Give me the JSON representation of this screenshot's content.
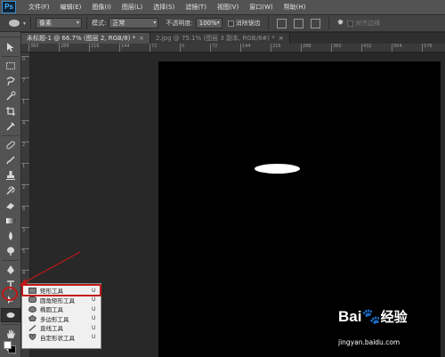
{
  "app": {
    "logo": "Ps",
    "menus": [
      "文件(F)",
      "编辑(E)",
      "图像(I)",
      "图层(L)",
      "选择(S)",
      "滤镜(T)",
      "视图(V)",
      "窗口(W)",
      "帮助(H)"
    ]
  },
  "options": {
    "mode_value": "像素",
    "mode_label": "模式:",
    "blend_value": "正常",
    "opacity_label": "不透明度:",
    "opacity_value": "100%",
    "antialias_label": "消除锯齿",
    "align_edges_label": "对齐边缘"
  },
  "tabs": [
    {
      "label": "未标题-1 @ 66.7% (图层 2, RGB/8) *",
      "close": "×",
      "active": true
    },
    {
      "label": "2.jpg @ 75.1% (图层 3 副本, RGB/8#) *",
      "close": "×",
      "active": false
    }
  ],
  "ruler_top": [
    "360",
    "288",
    "216",
    "144",
    "72",
    "0",
    "72",
    "144",
    "216",
    "288",
    "360",
    "432",
    "504",
    "576"
  ],
  "ruler_left": [
    "0",
    "7",
    "1",
    "4",
    "2",
    "1",
    "2",
    "8",
    "3",
    "5",
    "4",
    "3",
    "5",
    "0"
  ],
  "toolbox": {
    "tools": [
      "move",
      "marquee",
      "lasso",
      "quick-select",
      "crop",
      "eyedropper",
      "healing",
      "brush",
      "stamp",
      "history-brush",
      "eraser",
      "gradient",
      "blur",
      "dodge",
      "pen",
      "type",
      "path-select",
      "ellipse",
      "hand",
      "zoom"
    ]
  },
  "flyout": {
    "items": [
      {
        "label": "矩形工具",
        "shortcut": "U",
        "icon": "rectangle-icon"
      },
      {
        "label": "圆角矩形工具",
        "shortcut": "U",
        "icon": "rounded-rectangle-icon"
      },
      {
        "label": "椭圆工具",
        "shortcut": "U",
        "icon": "ellipse-icon"
      },
      {
        "label": "多边形工具",
        "shortcut": "U",
        "icon": "polygon-icon"
      },
      {
        "label": "直线工具",
        "shortcut": "U",
        "icon": "line-icon"
      },
      {
        "label": "自定形状工具",
        "shortcut": "U",
        "icon": "custom-shape-icon"
      }
    ]
  },
  "watermark": {
    "brand_a": "Bai",
    "brand_paw": "🐾",
    "brand_b": "经验",
    "url": "jingyan.baidu.com"
  },
  "colors": {
    "highlight": "#c01818",
    "canvas": "#000000",
    "shape": "#ffffff"
  }
}
